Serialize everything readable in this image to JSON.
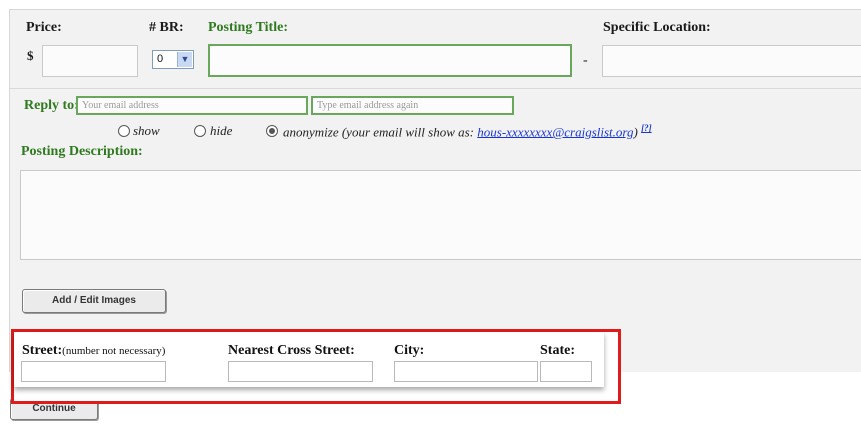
{
  "form": {
    "price_label": "Price:",
    "currency_symbol": "$",
    "br_label": "# BR:",
    "br_value": "0",
    "title_label": "Posting Title:",
    "dash": "-",
    "location_label": "Specific Location:",
    "reply_label": "Reply to:",
    "email_placeholder": "Your email address",
    "email_confirm_placeholder": "Type email address again",
    "privacy": {
      "show_label": "show",
      "hide_label": "hide",
      "anonymize_prefix": "anonymize (your email will show as: ",
      "anon_email": "hous-xxxxxxxx@craigslist.org",
      "anonymize_suffix": ")",
      "help_mark": "[?]",
      "selected": "anonymize"
    },
    "description_label": "Posting Description:",
    "add_images_label": "Add / Edit Images",
    "continue_label": "Continue"
  },
  "location_section": {
    "street_label": "Street:",
    "street_note": "(number not necessary)",
    "cross_street_label": "Nearest Cross Street:",
    "city_label": "City:",
    "state_label": "State:"
  },
  "colors": {
    "highlight": "#e01b1b",
    "label_green": "#2f7a1f",
    "link_blue": "#1a36d0"
  }
}
